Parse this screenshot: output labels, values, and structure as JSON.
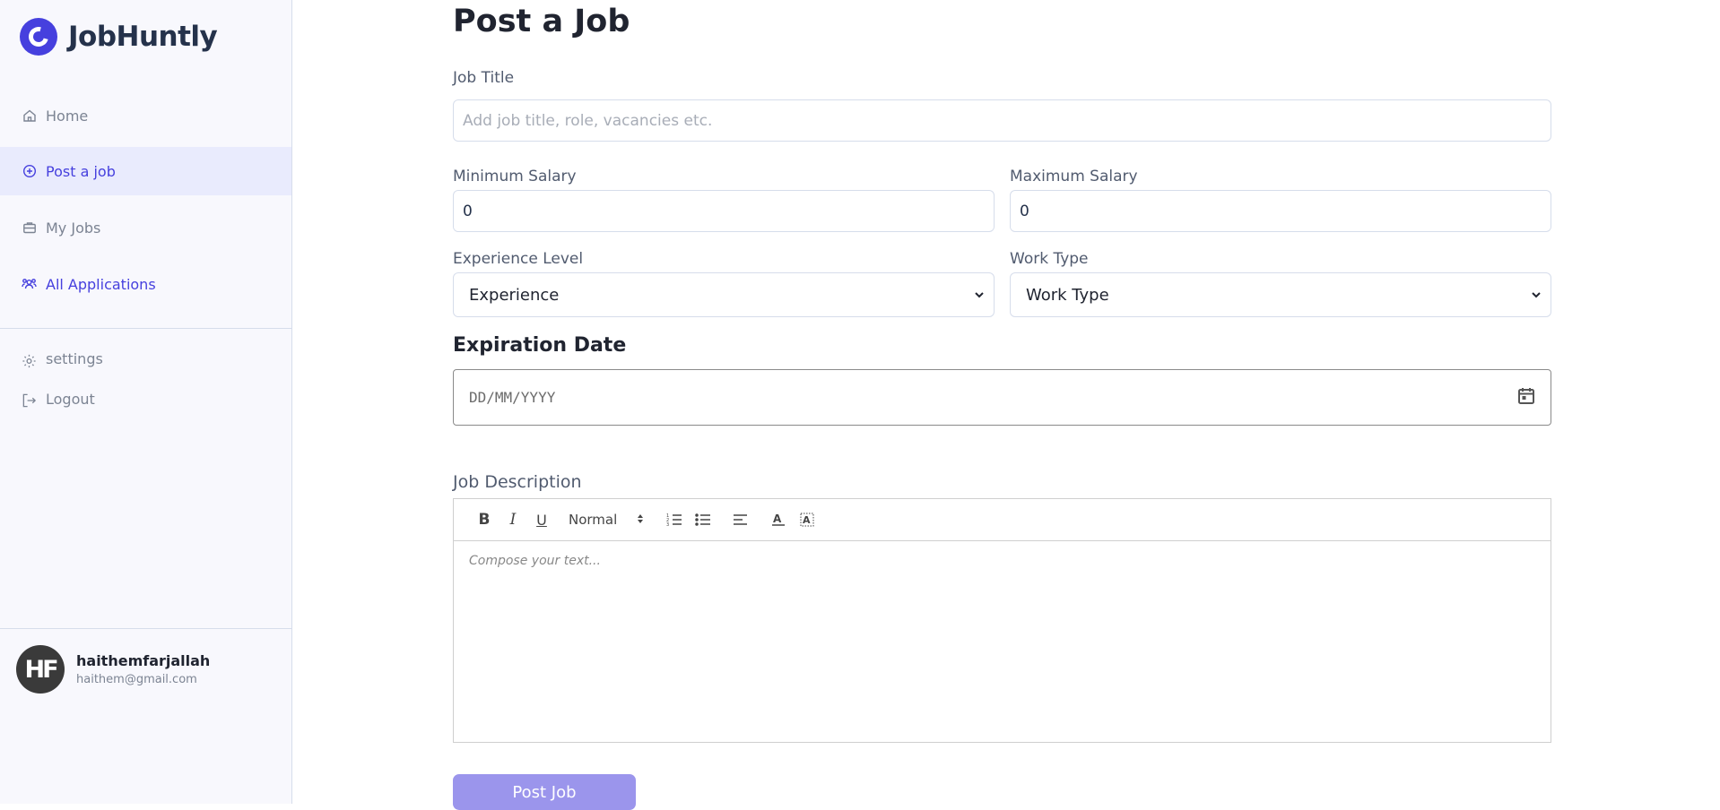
{
  "brand": {
    "name": "JobHuntly"
  },
  "nav": {
    "items": [
      {
        "label": "Home"
      },
      {
        "label": "Post a job"
      },
      {
        "label": "My Jobs"
      },
      {
        "label": "All Applications"
      }
    ],
    "secondary": [
      {
        "label": "settings"
      },
      {
        "label": "Logout"
      }
    ]
  },
  "user": {
    "initials": "HF",
    "name": "haithemfarjallah",
    "email": "haithem@gmail.com"
  },
  "form": {
    "title": "Post a Job",
    "job_title": {
      "label": "Job Title",
      "placeholder": "Add job title, role, vacancies etc."
    },
    "min_salary": {
      "label": "Minimum Salary",
      "value": "0"
    },
    "max_salary": {
      "label": "Maximum Salary",
      "value": "0"
    },
    "experience": {
      "label": "Experience Level",
      "value": "Experience"
    },
    "work_type": {
      "label": "Work Type",
      "value": "Work Type"
    },
    "expiration": {
      "label": "Expiration Date",
      "placeholder": "DD/MM/YYYY"
    },
    "description": {
      "label": "Job Description",
      "heading_select": "Normal",
      "placeholder": "Compose your text..."
    },
    "submit": "Post Job"
  },
  "colors": {
    "accent": "#4640de",
    "active_bg": "#e9ebfd",
    "button": "#9b95ec"
  }
}
